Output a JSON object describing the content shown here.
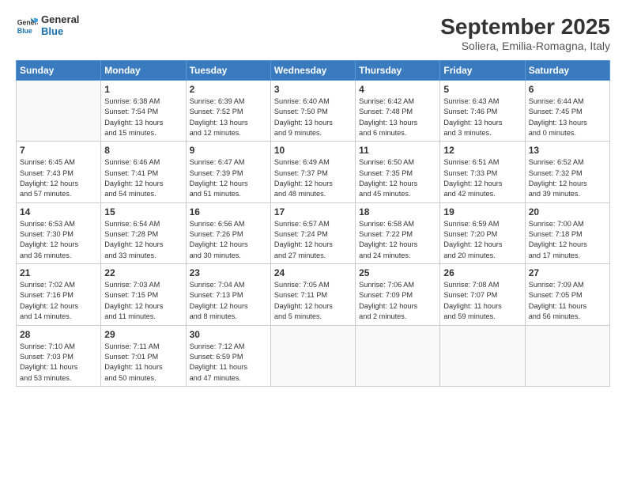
{
  "header": {
    "logo_line1": "General",
    "logo_line2": "Blue",
    "month_title": "September 2025",
    "subtitle": "Soliera, Emilia-Romagna, Italy"
  },
  "days_of_week": [
    "Sunday",
    "Monday",
    "Tuesday",
    "Wednesday",
    "Thursday",
    "Friday",
    "Saturday"
  ],
  "weeks": [
    [
      {
        "day": "",
        "info": ""
      },
      {
        "day": "1",
        "info": "Sunrise: 6:38 AM\nSunset: 7:54 PM\nDaylight: 13 hours\nand 15 minutes."
      },
      {
        "day": "2",
        "info": "Sunrise: 6:39 AM\nSunset: 7:52 PM\nDaylight: 13 hours\nand 12 minutes."
      },
      {
        "day": "3",
        "info": "Sunrise: 6:40 AM\nSunset: 7:50 PM\nDaylight: 13 hours\nand 9 minutes."
      },
      {
        "day": "4",
        "info": "Sunrise: 6:42 AM\nSunset: 7:48 PM\nDaylight: 13 hours\nand 6 minutes."
      },
      {
        "day": "5",
        "info": "Sunrise: 6:43 AM\nSunset: 7:46 PM\nDaylight: 13 hours\nand 3 minutes."
      },
      {
        "day": "6",
        "info": "Sunrise: 6:44 AM\nSunset: 7:45 PM\nDaylight: 13 hours\nand 0 minutes."
      }
    ],
    [
      {
        "day": "7",
        "info": "Sunrise: 6:45 AM\nSunset: 7:43 PM\nDaylight: 12 hours\nand 57 minutes."
      },
      {
        "day": "8",
        "info": "Sunrise: 6:46 AM\nSunset: 7:41 PM\nDaylight: 12 hours\nand 54 minutes."
      },
      {
        "day": "9",
        "info": "Sunrise: 6:47 AM\nSunset: 7:39 PM\nDaylight: 12 hours\nand 51 minutes."
      },
      {
        "day": "10",
        "info": "Sunrise: 6:49 AM\nSunset: 7:37 PM\nDaylight: 12 hours\nand 48 minutes."
      },
      {
        "day": "11",
        "info": "Sunrise: 6:50 AM\nSunset: 7:35 PM\nDaylight: 12 hours\nand 45 minutes."
      },
      {
        "day": "12",
        "info": "Sunrise: 6:51 AM\nSunset: 7:33 PM\nDaylight: 12 hours\nand 42 minutes."
      },
      {
        "day": "13",
        "info": "Sunrise: 6:52 AM\nSunset: 7:32 PM\nDaylight: 12 hours\nand 39 minutes."
      }
    ],
    [
      {
        "day": "14",
        "info": "Sunrise: 6:53 AM\nSunset: 7:30 PM\nDaylight: 12 hours\nand 36 minutes."
      },
      {
        "day": "15",
        "info": "Sunrise: 6:54 AM\nSunset: 7:28 PM\nDaylight: 12 hours\nand 33 minutes."
      },
      {
        "day": "16",
        "info": "Sunrise: 6:56 AM\nSunset: 7:26 PM\nDaylight: 12 hours\nand 30 minutes."
      },
      {
        "day": "17",
        "info": "Sunrise: 6:57 AM\nSunset: 7:24 PM\nDaylight: 12 hours\nand 27 minutes."
      },
      {
        "day": "18",
        "info": "Sunrise: 6:58 AM\nSunset: 7:22 PM\nDaylight: 12 hours\nand 24 minutes."
      },
      {
        "day": "19",
        "info": "Sunrise: 6:59 AM\nSunset: 7:20 PM\nDaylight: 12 hours\nand 20 minutes."
      },
      {
        "day": "20",
        "info": "Sunrise: 7:00 AM\nSunset: 7:18 PM\nDaylight: 12 hours\nand 17 minutes."
      }
    ],
    [
      {
        "day": "21",
        "info": "Sunrise: 7:02 AM\nSunset: 7:16 PM\nDaylight: 12 hours\nand 14 minutes."
      },
      {
        "day": "22",
        "info": "Sunrise: 7:03 AM\nSunset: 7:15 PM\nDaylight: 12 hours\nand 11 minutes."
      },
      {
        "day": "23",
        "info": "Sunrise: 7:04 AM\nSunset: 7:13 PM\nDaylight: 12 hours\nand 8 minutes."
      },
      {
        "day": "24",
        "info": "Sunrise: 7:05 AM\nSunset: 7:11 PM\nDaylight: 12 hours\nand 5 minutes."
      },
      {
        "day": "25",
        "info": "Sunrise: 7:06 AM\nSunset: 7:09 PM\nDaylight: 12 hours\nand 2 minutes."
      },
      {
        "day": "26",
        "info": "Sunrise: 7:08 AM\nSunset: 7:07 PM\nDaylight: 11 hours\nand 59 minutes."
      },
      {
        "day": "27",
        "info": "Sunrise: 7:09 AM\nSunset: 7:05 PM\nDaylight: 11 hours\nand 56 minutes."
      }
    ],
    [
      {
        "day": "28",
        "info": "Sunrise: 7:10 AM\nSunset: 7:03 PM\nDaylight: 11 hours\nand 53 minutes."
      },
      {
        "day": "29",
        "info": "Sunrise: 7:11 AM\nSunset: 7:01 PM\nDaylight: 11 hours\nand 50 minutes."
      },
      {
        "day": "30",
        "info": "Sunrise: 7:12 AM\nSunset: 6:59 PM\nDaylight: 11 hours\nand 47 minutes."
      },
      {
        "day": "",
        "info": ""
      },
      {
        "day": "",
        "info": ""
      },
      {
        "day": "",
        "info": ""
      },
      {
        "day": "",
        "info": ""
      }
    ]
  ]
}
